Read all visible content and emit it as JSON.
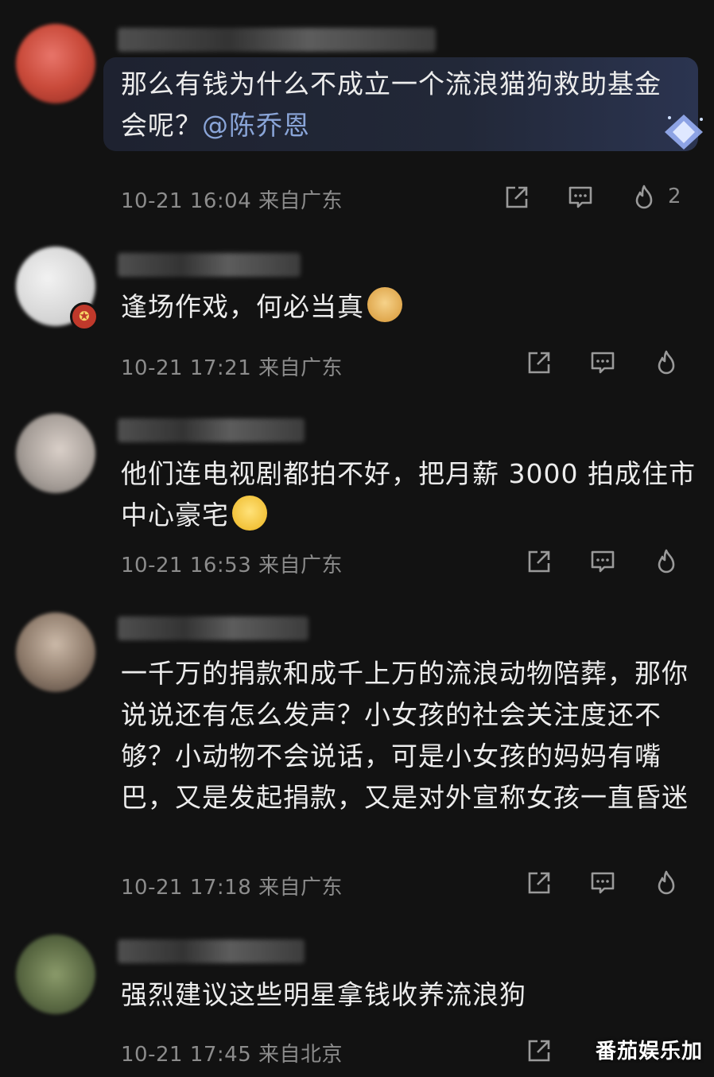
{
  "colors": {
    "background": "#121212",
    "text": "#ececec",
    "meta": "#8c8c8c",
    "mention": "#8aa5d8",
    "bubble": "#222838"
  },
  "comments": [
    {
      "text": "那么有钱为什么不成立一个流浪猫狗救助基金会呢？",
      "mention": "@陈乔恩",
      "time": "10-21 16:04",
      "location": "来自广东",
      "like_count": "2"
    },
    {
      "text": "逢场作戏，何必当真",
      "emoji": "doge-emoji",
      "time": "10-21 17:21",
      "location": "来自广东"
    },
    {
      "text": "他们连电视剧都拍不好，把月薪 3000 拍成住市中心豪宅",
      "emoji": "laugh-emoji",
      "time": "10-21 16:53",
      "location": "来自广东"
    },
    {
      "text": "一千万的捐款和成千上万的流浪动物陪葬，那你说说还有怎么发声？小女孩的社会关注度还不够？小动物不会说话，可是小女孩的妈妈有嘴巴，又是发起捐款，又是对外宣称女孩一直昏迷",
      "time": "10-21 17:18",
      "location": "来自广东"
    },
    {
      "text": "强烈建议这些明星拿钱收养流浪狗",
      "time": "10-21 17:45",
      "location": "来自北京"
    }
  ],
  "icons": {
    "share": "share-icon",
    "reply": "reply-icon",
    "like": "flame-icon"
  },
  "watermark": "番茄娱乐加"
}
